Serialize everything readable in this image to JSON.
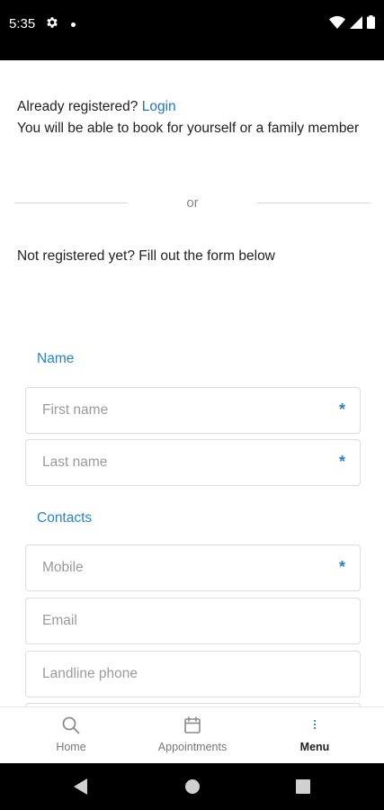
{
  "status_bar": {
    "time": "5:35"
  },
  "intro": {
    "already_registered": "Already registered?",
    "login_link": "Login",
    "book_text": "You will be able to book for yourself or a family member"
  },
  "divider": {
    "text": "or"
  },
  "not_registered": "Not registered yet? Fill out the form below",
  "form": {
    "name_section": "Name",
    "first_name_placeholder": "First name",
    "last_name_placeholder": "Last name",
    "contacts_section": "Contacts",
    "mobile_placeholder": "Mobile",
    "email_placeholder": "Email",
    "landline_placeholder": "Landline phone",
    "required_mark": "*"
  },
  "bottom_nav": {
    "items": [
      {
        "label": "Home",
        "icon": "search-icon"
      },
      {
        "label": "Appointments",
        "icon": "calendar-icon"
      },
      {
        "label": "Menu",
        "icon": "more-vertical-icon",
        "active": true
      }
    ]
  },
  "colors": {
    "accent": "#2a83c9",
    "link": "#1976d2",
    "status_bar": "#000000"
  }
}
